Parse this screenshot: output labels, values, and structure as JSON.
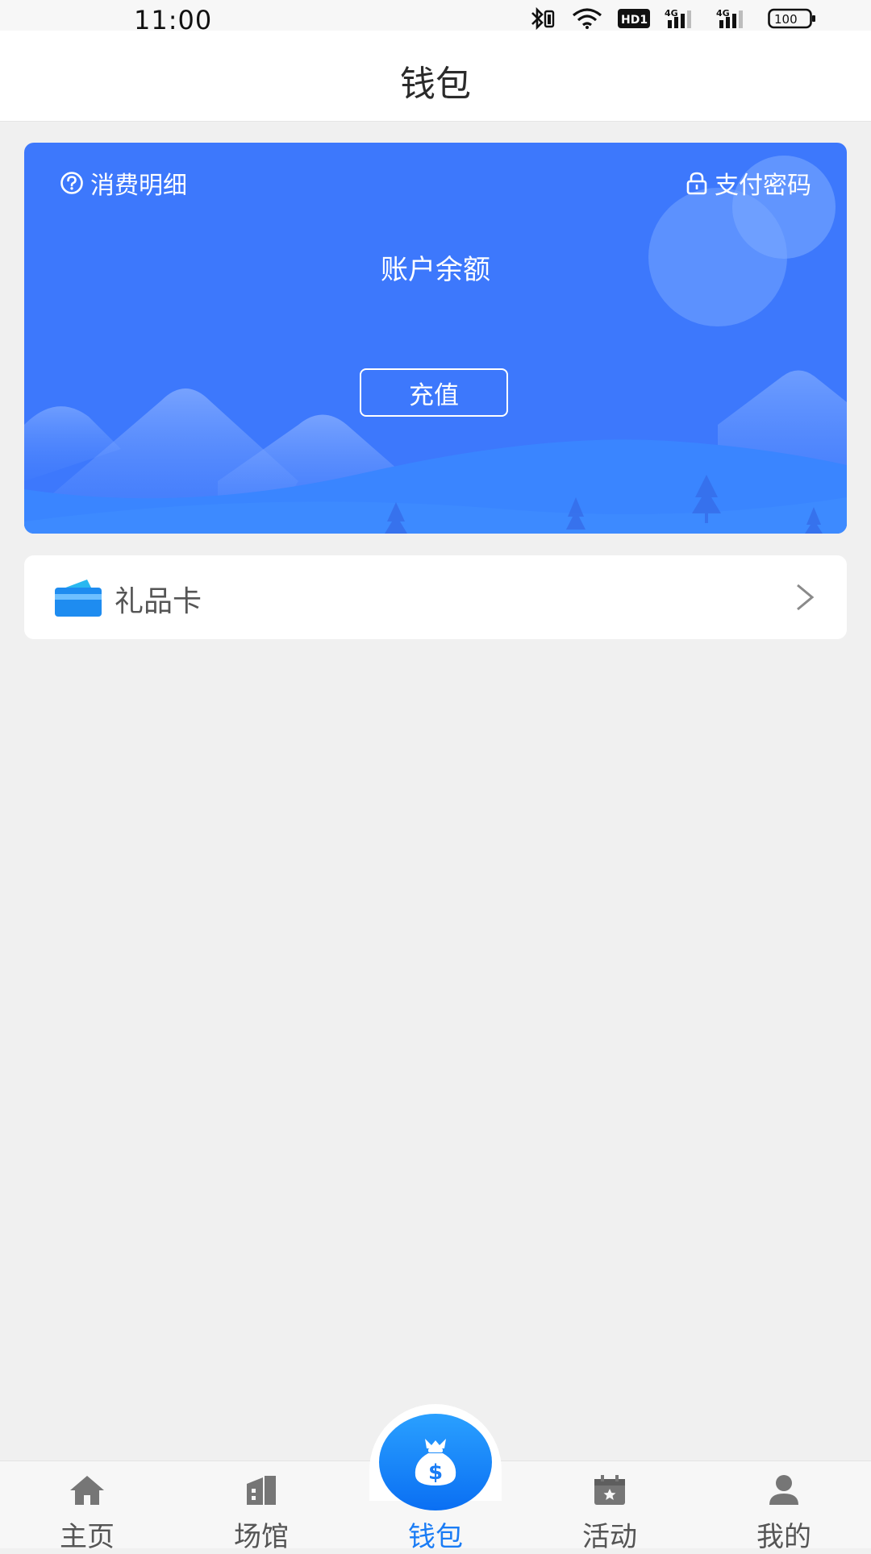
{
  "status_bar": {
    "time": "11:00",
    "network_1": "4G",
    "network_2": "4G",
    "hd_badge": "HD1",
    "battery": "100",
    "icons": [
      "bluetooth-icon",
      "wifi-icon",
      "hd-icon",
      "signal-icon",
      "signal-icon",
      "battery-icon"
    ]
  },
  "header": {
    "title": "钱包"
  },
  "wallet_card": {
    "details_link": "消费明细",
    "password_link": "支付密码",
    "balance_label": "账户余额",
    "recharge_button": "充值",
    "background_color": "#3d78fc"
  },
  "gift_card": {
    "label": "礼品卡",
    "icon": "card-icon"
  },
  "bottom_nav": {
    "active_color": "#1a7cf5",
    "items": [
      {
        "label": "主页",
        "icon": "home-icon"
      },
      {
        "label": "场馆",
        "icon": "building-icon"
      },
      {
        "label": "钱包",
        "icon": "money-bag-icon"
      },
      {
        "label": "活动",
        "icon": "calendar-star-icon"
      },
      {
        "label": "我的",
        "icon": "user-icon"
      }
    ]
  }
}
